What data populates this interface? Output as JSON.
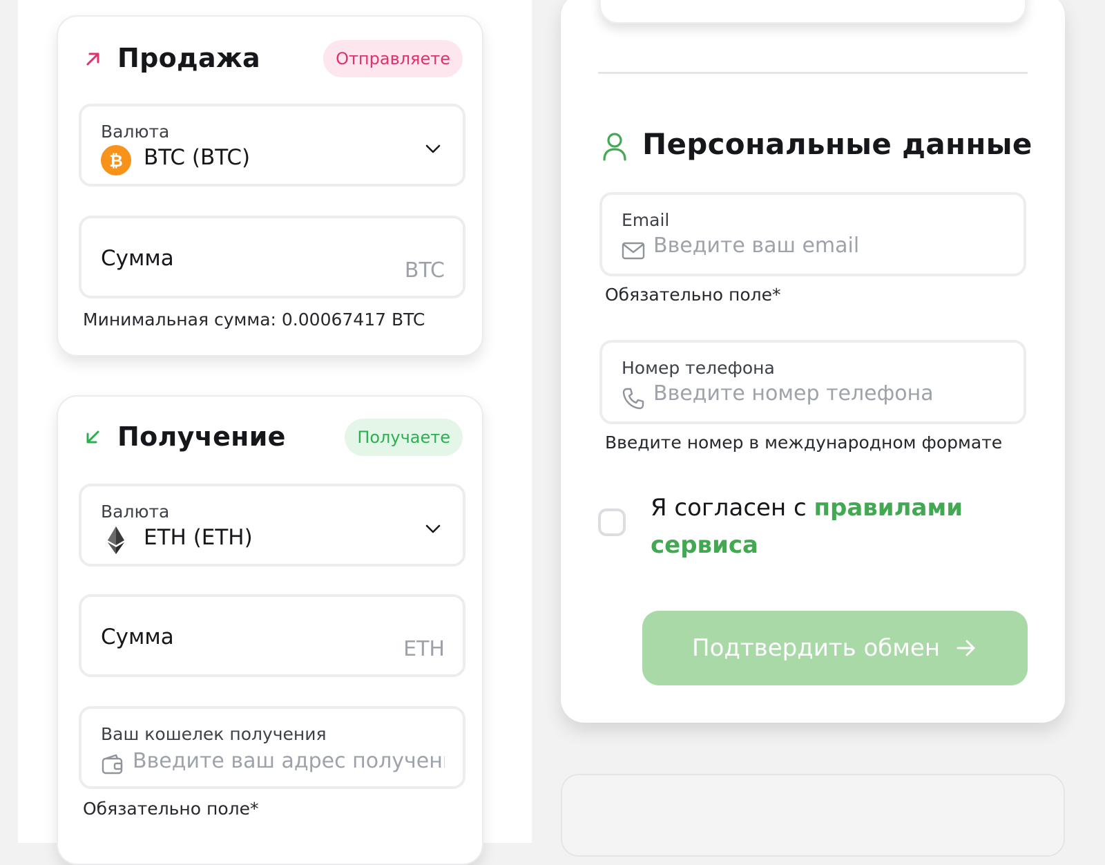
{
  "sell": {
    "title": "Продажа",
    "badge": "Отправляете",
    "currency_label": "Валюта",
    "currency_value": "BTC (BTC)",
    "amount_label": "Сумма",
    "amount_unit": "BTC",
    "min_amount": "Минимальная сумма: 0.00067417 BTC"
  },
  "receive": {
    "title": "Получение",
    "badge": "Получаете",
    "currency_label": "Валюта",
    "currency_value": "ETH (ETH)",
    "amount_label": "Сумма",
    "amount_unit": "ETH",
    "wallet_label": "Ваш кошелек получения",
    "wallet_placeholder": "Введите ваш адрес получения",
    "wallet_hint": "Обязательно поле*"
  },
  "personal": {
    "title": "Персональные данные",
    "email_label": "Email",
    "email_placeholder": "Введите ваш email",
    "email_hint": "Обязательно поле*",
    "phone_label": "Номер телефона",
    "phone_placeholder": "Введите номер телефона",
    "phone_hint": "Введите номер в международном формате",
    "agree_text": "Я согласен с ",
    "agree_link": "правилами сервиса",
    "confirm_button": "Подтвердить обмен"
  },
  "colors": {
    "send_accent": "#e0306e",
    "receive_accent": "#2bb04f",
    "link_green": "#42a851",
    "button_green": "#a8d9a7",
    "btc_orange": "#f7931a"
  },
  "icons": {
    "sell_arrow": "arrow-up-right-icon",
    "receive_arrow": "arrow-down-left-icon",
    "user": "user-icon",
    "email": "mail-icon",
    "phone": "phone-icon",
    "wallet": "wallet-icon",
    "dropdown": "chevron-down-icon",
    "confirm": "arrow-right-icon"
  }
}
